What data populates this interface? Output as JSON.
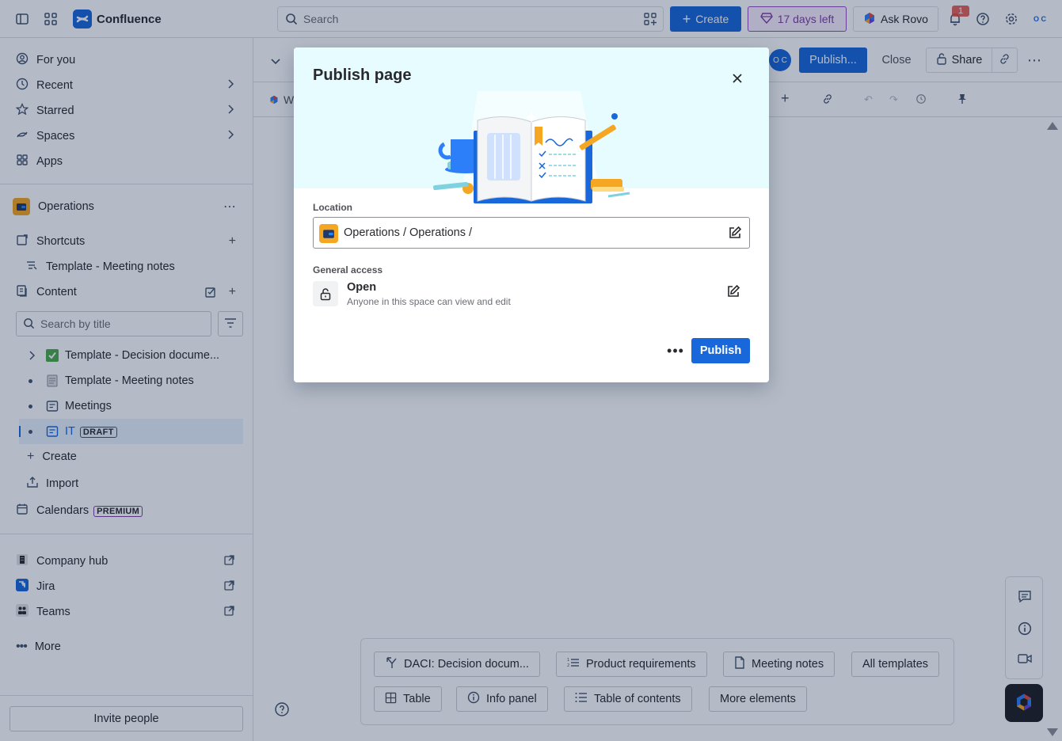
{
  "topbar": {
    "app_name": "Confluence",
    "search_placeholder": "Search",
    "create_label": "Create",
    "trial_label": "17 days left",
    "rovo_label": "Ask Rovo",
    "notification_count": "1",
    "avatar_initials": "O C"
  },
  "sidebar": {
    "nav": [
      {
        "label": "For you",
        "icon": "person-circle-icon"
      },
      {
        "label": "Recent",
        "icon": "clock-icon"
      },
      {
        "label": "Starred",
        "icon": "star-icon"
      },
      {
        "label": "Spaces",
        "icon": "spaces-icon"
      },
      {
        "label": "Apps",
        "icon": "apps-icon"
      }
    ],
    "space_name": "Operations",
    "shortcuts_label": "Shortcuts",
    "shortcut_item": "Template - Meeting notes",
    "content_label": "Content",
    "search_placeholder": "Search by title",
    "tree": [
      {
        "label": "Template - Decision docume..."
      },
      {
        "label": "Template - Meeting notes"
      },
      {
        "label": "Meetings"
      },
      {
        "label": "IT",
        "tag": "DRAFT"
      }
    ],
    "create_label": "Create",
    "import_label": "Import",
    "calendars_label": "Calendars",
    "premium_tag": "PREMIUM",
    "apps": [
      {
        "label": "Company hub"
      },
      {
        "label": "Jira"
      },
      {
        "label": "Teams"
      }
    ],
    "more_label": "More",
    "invite_label": "Invite people"
  },
  "page": {
    "avatar_initials": "O C",
    "publish_label": "Publish...",
    "close_label": "Close",
    "share_label": "Share",
    "breadcrumb_initial": "W"
  },
  "templates": {
    "row1": [
      "DACI: Decision docum...",
      "Product requirements",
      "Meeting notes",
      "All templates"
    ],
    "row2": [
      "Table",
      "Info panel",
      "Table of contents",
      "More elements"
    ]
  },
  "modal": {
    "title": "Publish page",
    "location_label": "Location",
    "location_value": "Operations / Operations /",
    "access_label": "General access",
    "access_title": "Open",
    "access_desc": "Anyone in this space can view and edit",
    "publish_label": "Publish"
  }
}
